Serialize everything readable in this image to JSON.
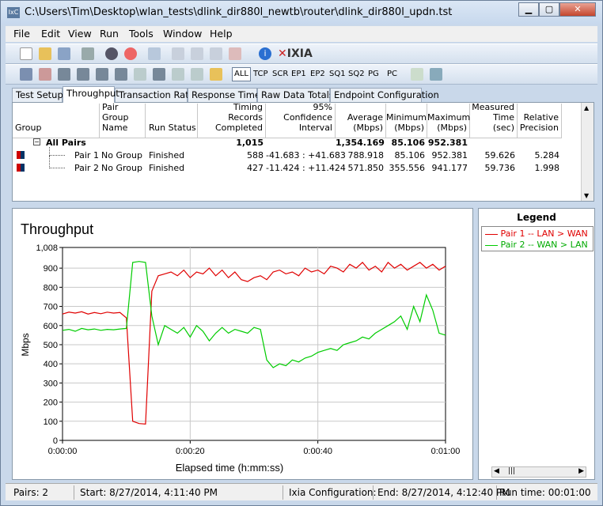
{
  "window": {
    "title": "C:\\Users\\Tim\\Desktop\\wlan_tests\\dlink_dir880l_newtb\\router\\dlink_dir880l_updn.tst",
    "icon_text": "IxC"
  },
  "menu": [
    "File",
    "Edit",
    "View",
    "Run",
    "Tools",
    "Window",
    "Help"
  ],
  "toolbar1": {
    "brand": "IXIA"
  },
  "toolbar2": {
    "selected": "ALL",
    "filters": [
      "TCP",
      "SCR",
      "EP1",
      "EP2",
      "SQ1",
      "SQ2",
      "PG",
      "PC"
    ]
  },
  "tabs": [
    "Test Setup",
    "Throughput",
    "Transaction Rate",
    "Response Time",
    "Raw Data Totals",
    "Endpoint Configuration"
  ],
  "active_tab": "Throughput",
  "grid": {
    "headers": [
      "Group",
      "Pair Group Name",
      "Run Status",
      "Timing Records Completed",
      "95% Confidence Interval",
      "Average (Mbps)",
      "Minimum (Mbps)",
      "Maximum (Mbps)",
      "Measured Time (sec)",
      "Relative Precision"
    ],
    "all_pairs": {
      "label": "All Pairs",
      "records": "1,015",
      "average": "1,354.169",
      "minimum": "85.106",
      "maximum": "952.381"
    },
    "rows": [
      {
        "name": "Pair 1",
        "group": "No Group",
        "status": "Finished",
        "records": "588",
        "ci": "-41.683 : +41.683",
        "average": "788.918",
        "minimum": "85.106",
        "maximum": "952.381",
        "time": "59.626",
        "precision": "5.284"
      },
      {
        "name": "Pair 2",
        "group": "No Group",
        "status": "Finished",
        "records": "427",
        "ci": "-11.424 : +11.424",
        "average": "571.850",
        "minimum": "355.556",
        "maximum": "941.177",
        "time": "59.736",
        "precision": "1.998"
      }
    ]
  },
  "chart_data": {
    "type": "line",
    "title": "Throughput",
    "xlabel": "Elapsed time (h:mm:ss)",
    "ylabel": "Mbps",
    "ylim": [
      0,
      1008
    ],
    "yticks": [
      "0",
      "100",
      "200",
      "300",
      "400",
      "500",
      "600",
      "700",
      "800",
      "900",
      "1,008"
    ],
    "xlim": [
      0,
      60
    ],
    "xticks": [
      "0:00:00",
      "0:00:20",
      "0:00:40",
      "0:01:00"
    ],
    "series": [
      {
        "name": "Pair 1 -- LAN > WAN",
        "color": "#e00000",
        "x": [
          0,
          1,
          2,
          3,
          4,
          5,
          6,
          7,
          8,
          9,
          10,
          11,
          12,
          13,
          14,
          15,
          16,
          17,
          18,
          19,
          20,
          21,
          22,
          23,
          24,
          25,
          26,
          27,
          28,
          29,
          30,
          31,
          32,
          33,
          34,
          35,
          36,
          37,
          38,
          39,
          40,
          41,
          42,
          43,
          44,
          45,
          46,
          47,
          48,
          49,
          50,
          51,
          52,
          53,
          54,
          55,
          56,
          57,
          58,
          59,
          60
        ],
        "values": [
          660,
          670,
          665,
          672,
          660,
          668,
          662,
          670,
          665,
          668,
          640,
          100,
          88,
          85,
          780,
          860,
          870,
          880,
          860,
          890,
          850,
          880,
          870,
          900,
          860,
          890,
          850,
          880,
          840,
          830,
          850,
          860,
          840,
          880,
          890,
          870,
          880,
          860,
          900,
          880,
          890,
          870,
          910,
          900,
          880,
          920,
          900,
          930,
          890,
          910,
          880,
          930,
          900,
          920,
          890,
          910,
          930,
          900,
          920,
          890,
          910
        ]
      },
      {
        "name": "Pair 2 -- WAN > LAN",
        "color": "#00cc00",
        "x": [
          0,
          1,
          2,
          3,
          4,
          5,
          6,
          7,
          8,
          9,
          10,
          11,
          12,
          13,
          14,
          15,
          16,
          17,
          18,
          19,
          20,
          21,
          22,
          23,
          24,
          25,
          26,
          27,
          28,
          29,
          30,
          31,
          32,
          33,
          34,
          35,
          36,
          37,
          38,
          39,
          40,
          41,
          42,
          43,
          44,
          45,
          46,
          47,
          48,
          49,
          50,
          51,
          52,
          53,
          54,
          55,
          56,
          57,
          58,
          59,
          60
        ],
        "values": [
          575,
          580,
          570,
          585,
          578,
          582,
          575,
          580,
          578,
          582,
          585,
          930,
          935,
          930,
          650,
          500,
          600,
          580,
          560,
          590,
          540,
          600,
          570,
          520,
          560,
          590,
          560,
          580,
          570,
          560,
          590,
          580,
          420,
          380,
          400,
          390,
          420,
          410,
          430,
          440,
          460,
          470,
          480,
          470,
          500,
          510,
          520,
          540,
          530,
          560,
          580,
          600,
          620,
          650,
          580,
          700,
          620,
          760,
          680,
          560,
          550
        ]
      }
    ],
    "grid": true,
    "legend": "right-pane"
  },
  "legend": {
    "title": "Legend",
    "items": [
      "Pair 1 -- LAN > WAN",
      "Pair 2 -- WAN > LAN"
    ]
  },
  "status": {
    "pairs": "Pairs: 2",
    "start": "Start: 8/27/2014, 4:11:40 PM",
    "config": "Ixia Configuration:",
    "end": "End: 8/27/2014, 4:12:40 PM",
    "runtime": "Run time: 00:01:00"
  }
}
